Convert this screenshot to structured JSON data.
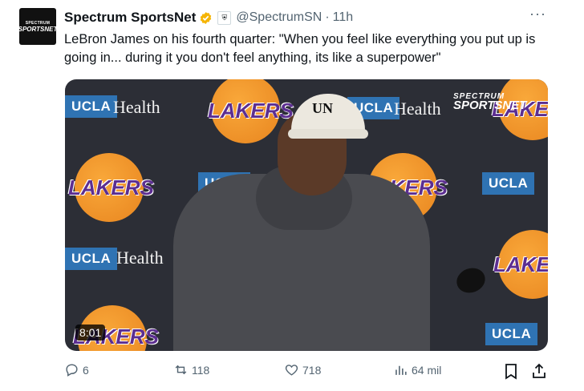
{
  "tweet": {
    "avatar": {
      "line1": "SPECTRUM",
      "line2": "SPORTSNET"
    },
    "name": "Spectrum SportsNet",
    "handle": "@SpectrumSN",
    "separator": "·",
    "time": "11h",
    "more_label": "···",
    "text": "LeBron James on his fourth quarter: \"When you feel like everything you put up is going in... during it you don't feel anything, its like a superpower\"",
    "media": {
      "duration": "8:01",
      "overlay_logo": {
        "line1": "SPECTRUM",
        "line2": "SPORTSNET"
      },
      "backdrop": {
        "ucla": "UCLA",
        "health": "Health",
        "lakers": "LAKERS"
      },
      "cap_text": "UN"
    },
    "actions": {
      "replies": "6",
      "reposts": "118",
      "likes": "718",
      "views": "64 mil"
    }
  },
  "colors": {
    "verified_badge": "#f5b400",
    "ucla_blue": "#2f73b3",
    "lakers_gold": "#f9a83a",
    "lakers_purple": "#5c2e91",
    "muted_text": "#536471"
  }
}
